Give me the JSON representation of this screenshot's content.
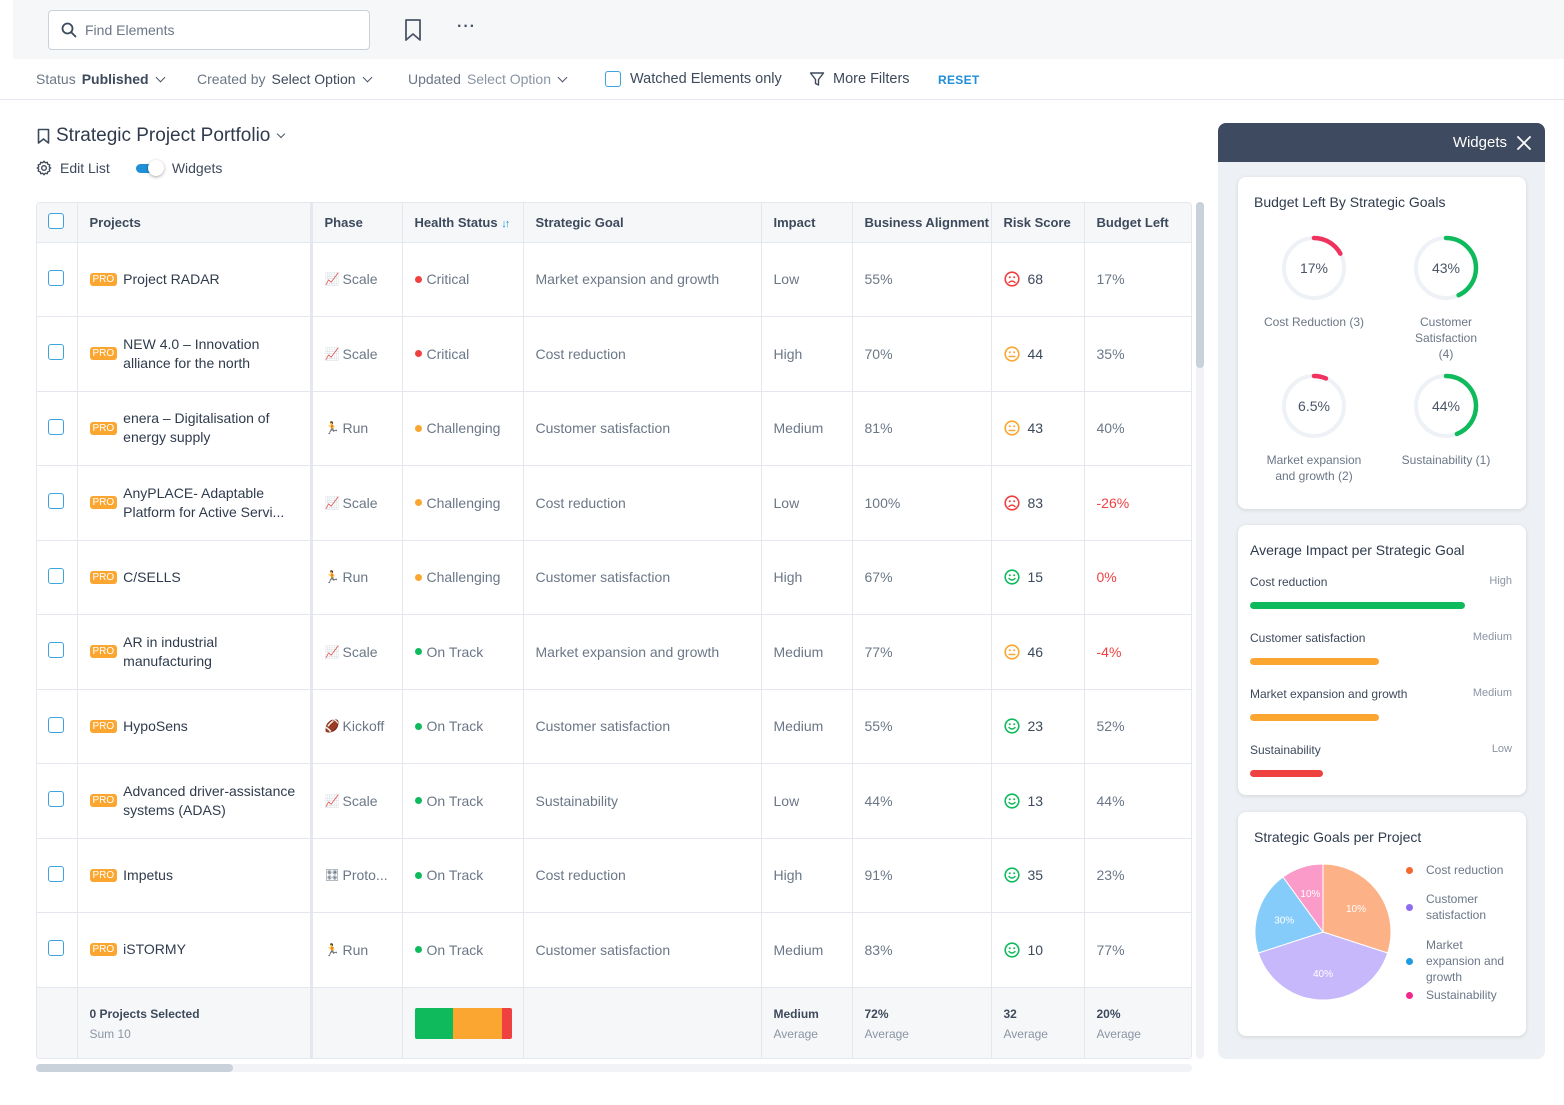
{
  "search": {
    "placeholder": "Find Elements",
    "value": ""
  },
  "filters": {
    "status_label": "Status",
    "status_value": "Published",
    "created_label": "Created by",
    "created_value": "Select Option",
    "updated_label": "Updated",
    "updated_value": "Select Option",
    "watched_label": "Watched Elements only",
    "more_filters_label": "More Filters",
    "reset_label": "RESET"
  },
  "page": {
    "title": "Strategic Project Portfolio",
    "edit_list_label": "Edit List",
    "widgets_toggle_label": "Widgets",
    "widgets_toggle_on": true
  },
  "table": {
    "columns": [
      "Projects",
      "Phase",
      "Health Status",
      "Strategic Goal",
      "Impact",
      "Business Alignment",
      "Risk Score",
      "Budget Left"
    ],
    "pro_badge": "PRO",
    "rows": [
      {
        "project": "Project RADAR",
        "phase": "Scale",
        "phase_icon": "chart-up-icon",
        "health": "Critical",
        "goal": "Market expansion and growth",
        "impact": "Low",
        "alignment": "55%",
        "risk": "68",
        "risk_mood": "sad",
        "budget": "17%",
        "budget_negative": false
      },
      {
        "project": "NEW 4.0 – Innovation alliance for the north",
        "phase": "Scale",
        "phase_icon": "chart-up-icon",
        "health": "Critical",
        "goal": "Cost reduction",
        "impact": "High",
        "alignment": "70%",
        "risk": "44",
        "risk_mood": "neutral",
        "budget": "35%",
        "budget_negative": false
      },
      {
        "project": "enera – Digitalisation of energy supply",
        "phase": "Run",
        "phase_icon": "runner-icon",
        "health": "Challenging",
        "goal": "Customer satisfaction",
        "impact": "Medium",
        "alignment": "81%",
        "risk": "43",
        "risk_mood": "neutral",
        "budget": "40%",
        "budget_negative": false
      },
      {
        "project": "AnyPLACE- Adaptable Platform for Active Servi...",
        "phase": "Scale",
        "phase_icon": "chart-up-icon",
        "health": "Challenging",
        "goal": "Cost reduction",
        "impact": "Low",
        "alignment": "100%",
        "risk": "83",
        "risk_mood": "sad",
        "budget": "-26%",
        "budget_negative": true
      },
      {
        "project": "C/SELLS",
        "phase": "Run",
        "phase_icon": "runner-icon",
        "health": "Challenging",
        "goal": "Customer satisfaction",
        "impact": "High",
        "alignment": "67%",
        "risk": "15",
        "risk_mood": "happy",
        "budget": "0%",
        "budget_negative": true
      },
      {
        "project": "AR in industrial manufacturing",
        "phase": "Scale",
        "phase_icon": "chart-up-icon",
        "health": "On Track",
        "goal": "Market expansion and growth",
        "impact": "Medium",
        "alignment": "77%",
        "risk": "46",
        "risk_mood": "neutral",
        "budget": "-4%",
        "budget_negative": true
      },
      {
        "project": "HypoSens",
        "phase": "Kickoff",
        "phase_icon": "football-icon",
        "health": "On Track",
        "goal": "Customer satisfaction",
        "impact": "Medium",
        "alignment": "55%",
        "risk": "23",
        "risk_mood": "happy",
        "budget": "52%",
        "budget_negative": false
      },
      {
        "project": "Advanced driver-assistance systems (ADAS)",
        "phase": "Scale",
        "phase_icon": "chart-up-icon",
        "health": "On Track",
        "goal": "Sustainability",
        "impact": "Low",
        "alignment": "44%",
        "risk": "13",
        "risk_mood": "happy",
        "budget": "44%",
        "budget_negative": false
      },
      {
        "project": "Impetus",
        "phase": "Proto...",
        "phase_icon": "prototype-grid-icon",
        "health": "On Track",
        "goal": "Cost reduction",
        "impact": "High",
        "alignment": "91%",
        "risk": "35",
        "risk_mood": "happy",
        "budget": "23%",
        "budget_negative": false
      },
      {
        "project": "iSTORMY",
        "phase": "Run",
        "phase_icon": "runner-icon",
        "health": "On Track",
        "goal": "Customer satisfaction",
        "impact": "Medium",
        "alignment": "83%",
        "risk": "10",
        "risk_mood": "happy",
        "budget": "77%",
        "budget_negative": false
      }
    ],
    "footer": {
      "selected": "0 Projects Selected",
      "sum": "Sum 10",
      "health_distribution": [
        {
          "status": "On Track",
          "fraction": 0.4
        },
        {
          "status": "Challenging",
          "fraction": 0.5
        },
        {
          "status": "Critical",
          "fraction": 0.1
        }
      ],
      "impact_value": "Medium",
      "impact_caption": "Average",
      "alignment_value": "72%",
      "alignment_caption": "Average",
      "risk_value": "32",
      "risk_caption": "Average",
      "budget_value": "20%",
      "budget_caption": "Average"
    }
  },
  "colors": {
    "critical": "#f04141",
    "challenging": "#fba630",
    "on_track": "#0fba5c",
    "accent": "#1f8fd6",
    "donut_low": "#f0325f",
    "donut_high": "#0fba5c",
    "track": "#eef1f5"
  },
  "widgets": {
    "panel_title": "Widgets",
    "budget_card": {
      "title": "Budget Left By Strategic Goals",
      "items": [
        {
          "label": "Cost Reduction (3)",
          "value_text": "17%",
          "percent": 17,
          "color": "#f0325f"
        },
        {
          "label": "Customer Satisfaction (4)",
          "value_text": "43%",
          "percent": 43,
          "color": "#0fba5c"
        },
        {
          "label": "Market expansion and growth (2)",
          "value_text": "6.5%",
          "percent": 6.5,
          "color": "#f0325f"
        },
        {
          "label": "Sustainability (1)",
          "value_text": "44%",
          "percent": 44,
          "color": "#0fba5c"
        }
      ]
    },
    "impact_card": {
      "title": "Average Impact per Strategic Goal",
      "items": [
        {
          "goal": "Cost reduction",
          "level": "High",
          "fraction": 1.0,
          "color": "#0fba5c"
        },
        {
          "goal": "Customer satisfaction",
          "level": "Medium",
          "fraction": 0.6,
          "color": "#fba630"
        },
        {
          "goal": "Market expansion and growth",
          "level": "Medium",
          "fraction": 0.6,
          "color": "#fba630"
        },
        {
          "goal": "Sustainability",
          "level": "Low",
          "fraction": 0.34,
          "color": "#f04141"
        }
      ]
    },
    "pie_card": {
      "title": "Strategic Goals per Project"
    }
  },
  "chart_data": {
    "type": "pie",
    "title": "Strategic Goals per Project",
    "legend_position": "right",
    "slices": [
      {
        "name": "Cost reduction",
        "label": "10%",
        "share": 0.3,
        "color": "#fdb187",
        "legend_color": "#f5672d"
      },
      {
        "name": "Customer satisfaction",
        "label": "40%",
        "share": 0.4,
        "color": "#c7b8fb",
        "legend_color": "#8e6cf0"
      },
      {
        "name": "Market expansion and growth",
        "label": "30%",
        "share": 0.2,
        "color": "#86ccfb",
        "legend_color": "#1f9be0"
      },
      {
        "name": "Sustainability",
        "label": "10%",
        "share": 0.1,
        "color": "#fa9bc9",
        "legend_color": "#f0298c"
      }
    ]
  }
}
